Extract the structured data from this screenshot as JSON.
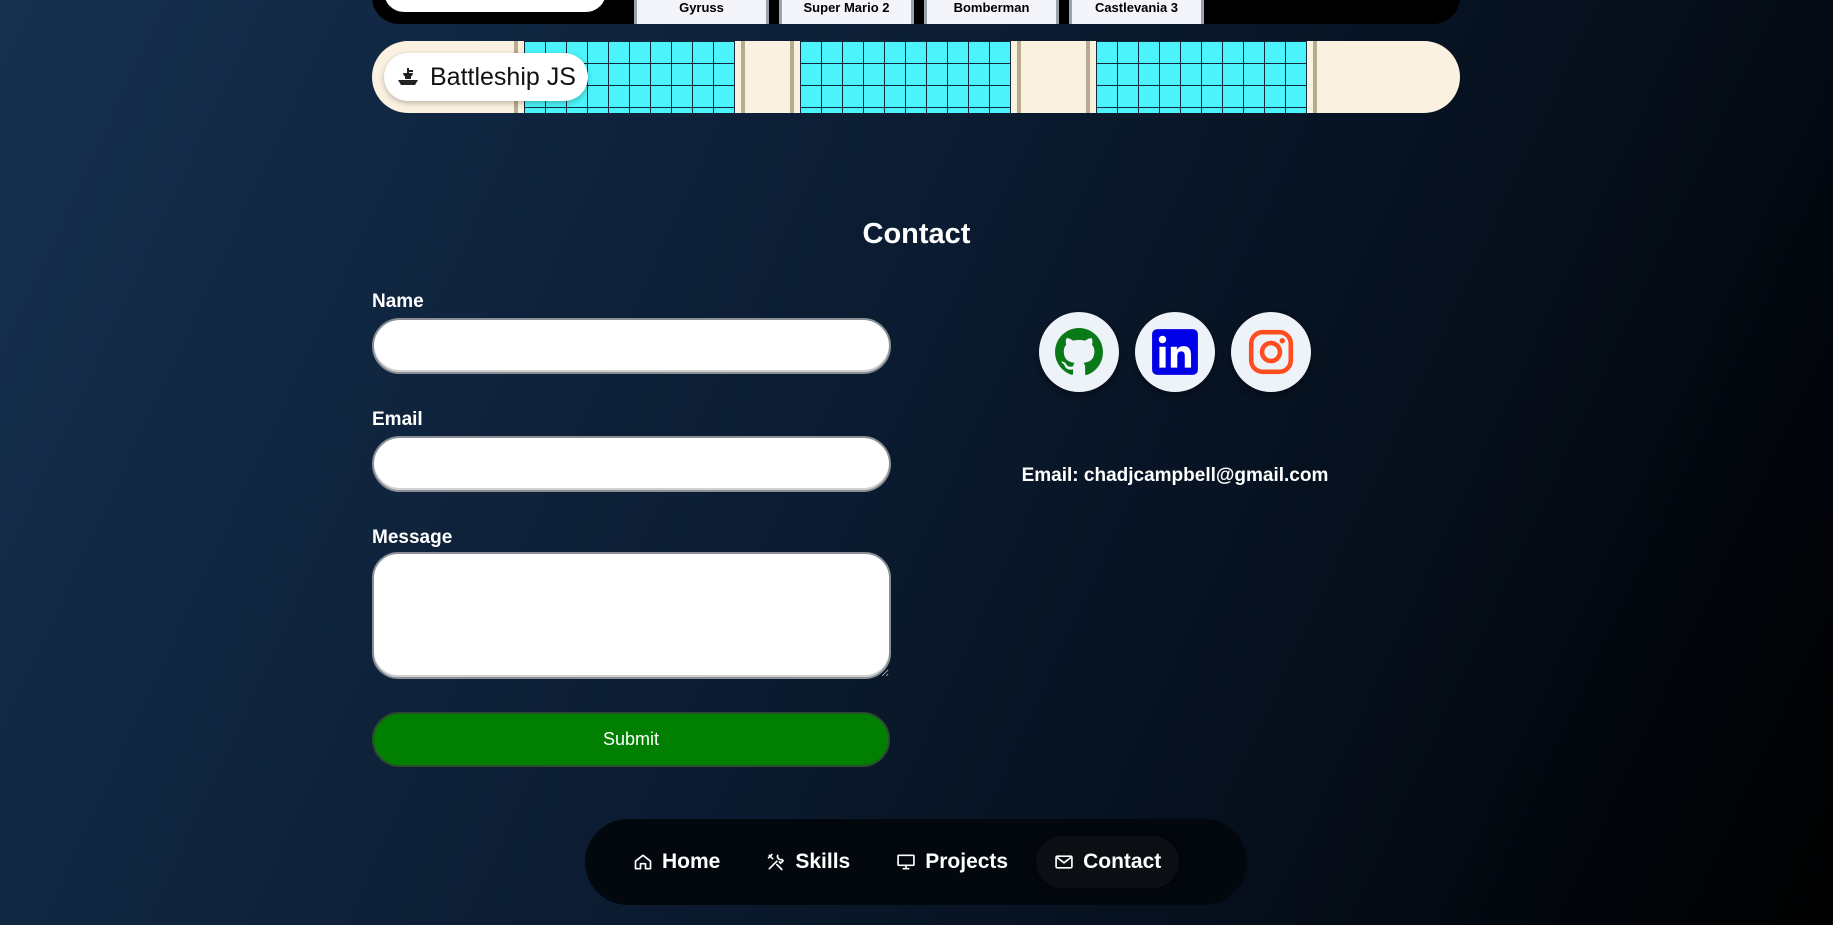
{
  "projects": {
    "top_row_games": [
      "Gyruss",
      "Super Mario 2",
      "Bomberman",
      "Castlevania 3"
    ],
    "battleship": {
      "title": "Battleship JS",
      "icon": "ship-icon"
    }
  },
  "contact": {
    "heading": "Contact",
    "form": {
      "name_label": "Name",
      "name_value": "",
      "email_label": "Email",
      "email_value": "",
      "message_label": "Message",
      "message_value": "",
      "submit_label": "Submit"
    },
    "social": [
      {
        "name": "github",
        "icon": "github-icon",
        "color": "#0a7a19"
      },
      {
        "name": "linkedin",
        "icon": "linkedin-icon",
        "color": "#0000e6"
      },
      {
        "name": "instagram",
        "icon": "instagram-icon",
        "color": "#ff4d1f"
      }
    ],
    "email_text": "Email: chadjcampbell@gmail.com"
  },
  "nav": {
    "items": [
      {
        "label": "Home",
        "icon": "home-icon",
        "active": false
      },
      {
        "label": "Skills",
        "icon": "tools-icon",
        "active": false
      },
      {
        "label": "Projects",
        "icon": "monitor-icon",
        "active": false
      },
      {
        "label": "Contact",
        "icon": "mail-icon",
        "active": true
      }
    ]
  },
  "colors": {
    "submit_bg": "#017f01",
    "board_cell": "#4cf3fa",
    "banner_bg": "#fbf1e1"
  }
}
